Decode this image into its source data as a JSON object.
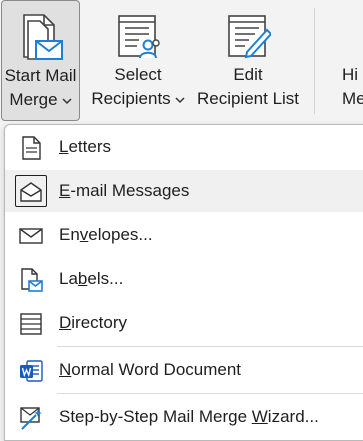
{
  "ribbon": {
    "start_mail_merge": {
      "line1": "Start Mail",
      "line2": "Merge"
    },
    "select_recipients": {
      "line1": "Select",
      "line2": "Recipients"
    },
    "edit_recipient_list": {
      "line1": "Edit",
      "line2": "Recipient List"
    },
    "highlight_merge_fields": {
      "line1": "Hi",
      "line2": "Merg"
    }
  },
  "menu": {
    "items": [
      {
        "pre": "",
        "ul": "L",
        "post": "etters",
        "icon": "letter-document-icon",
        "highlighted": false
      },
      {
        "pre": "",
        "ul": "E",
        "post": "-mail Messages",
        "icon": "open-envelope-icon",
        "highlighted": true
      },
      {
        "pre": "En",
        "ul": "v",
        "post": "elopes...",
        "icon": "envelope-icon",
        "highlighted": false
      },
      {
        "pre": "La",
        "ul": "b",
        "post": "els...",
        "icon": "labels-icon",
        "highlighted": false
      },
      {
        "pre": "",
        "ul": "D",
        "post": "irectory",
        "icon": "directory-icon",
        "highlighted": false
      },
      {
        "pre": "",
        "ul": "N",
        "post": "ormal Word Document",
        "icon": "word-document-icon",
        "highlighted": false
      },
      {
        "pre": "Step-by-Step Mail Merge ",
        "ul": "W",
        "post": "izard...",
        "icon": "wizard-icon",
        "highlighted": false
      }
    ]
  },
  "colors": {
    "accent_blue": "#1f7fd4",
    "word_blue": "#185abd",
    "highlight": "#f0f0f0"
  }
}
